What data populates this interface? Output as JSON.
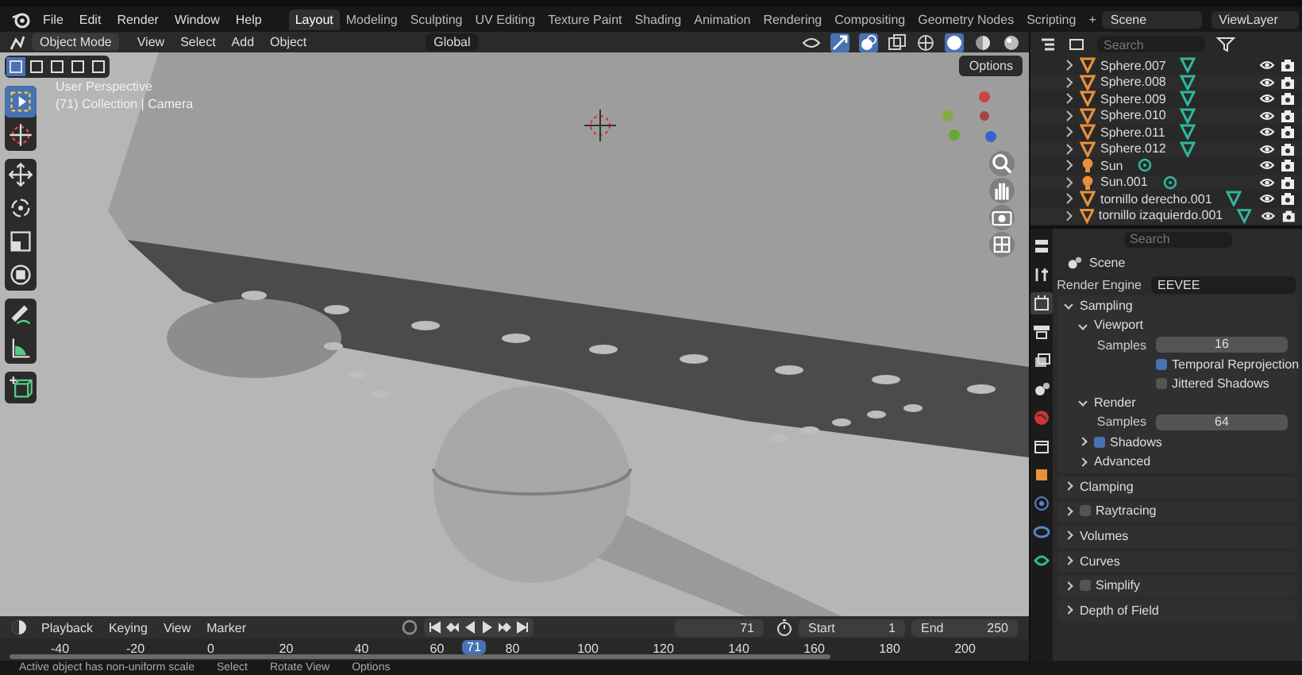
{
  "menu": [
    "File",
    "Edit",
    "Render",
    "Window",
    "Help"
  ],
  "workspaces": [
    {
      "label": "Layout",
      "selected": true
    },
    {
      "label": "Modeling",
      "selected": false
    },
    {
      "label": "Sculpting",
      "selected": false
    },
    {
      "label": "UV Editing",
      "selected": false
    },
    {
      "label": "Texture Paint",
      "selected": false
    },
    {
      "label": "Shading",
      "selected": false
    },
    {
      "label": "Animation",
      "selected": false
    },
    {
      "label": "Rendering",
      "selected": false
    },
    {
      "label": "Compositing",
      "selected": false
    },
    {
      "label": "Geometry Nodes",
      "selected": false
    },
    {
      "label": "Scripting",
      "selected": false
    }
  ],
  "add_workspace": "+",
  "scene": "Scene",
  "view_layer": "ViewLayer",
  "viewport_header": {
    "mode": "Object Mode",
    "menus": [
      "View",
      "Select",
      "Add",
      "Object"
    ],
    "orientation": "Global",
    "options": "Options"
  },
  "viewport": {
    "view_name": "User Perspective",
    "context": "(71) Collection | Camera"
  },
  "outliner": {
    "search_placeholder": "Search",
    "items": [
      {
        "name": "Sphere.007",
        "kind": "mesh"
      },
      {
        "name": "Sphere.008",
        "kind": "mesh"
      },
      {
        "name": "Sphere.009",
        "kind": "mesh"
      },
      {
        "name": "Sphere.010",
        "kind": "mesh"
      },
      {
        "name": "Sphere.011",
        "kind": "mesh"
      },
      {
        "name": "Sphere.012",
        "kind": "mesh"
      },
      {
        "name": "Sun",
        "kind": "light"
      },
      {
        "name": "Sun.001",
        "kind": "light"
      },
      {
        "name": "tornillo derecho.001",
        "kind": "mesh"
      },
      {
        "name": "tornillo izaquierdo.001",
        "kind": "mesh"
      }
    ]
  },
  "properties": {
    "search_placeholder": "Search",
    "context": "Scene",
    "render_engine_label": "Render Engine",
    "render_engine": "EEVEE",
    "sampling": {
      "label": "Sampling",
      "expanded": true,
      "subpanels": [
        {
          "label": "Viewport",
          "expanded": true,
          "rows": [
            {
              "kind": "number",
              "label": "Samples",
              "value": "16"
            },
            {
              "kind": "checkbox",
              "label": "Temporal Reprojection",
              "checked": true
            },
            {
              "kind": "checkbox",
              "label": "Jittered Shadows",
              "checked": false
            }
          ]
        },
        {
          "label": "Render",
          "expanded": true,
          "rows": [
            {
              "kind": "number",
              "label": "Samples",
              "value": "64"
            }
          ]
        },
        {
          "label": "Shadows",
          "expanded": false,
          "checked": true
        },
        {
          "label": "Advanced",
          "expanded": false
        }
      ]
    },
    "panels": [
      {
        "label": "Clamping",
        "expanded": false
      },
      {
        "label": "Raytracing",
        "expanded": false,
        "checked": false
      },
      {
        "label": "Volumes",
        "expanded": false
      },
      {
        "label": "Curves",
        "expanded": false
      },
      {
        "label": "Simplify",
        "expanded": false,
        "checked": false
      },
      {
        "label": "Depth of Field",
        "expanded": false
      }
    ]
  },
  "timeline": {
    "menus": [
      "Playback",
      "Keying",
      "View",
      "Marker"
    ],
    "frame": "71",
    "start_label": "Start",
    "start": "1",
    "end_label": "End",
    "end": "250",
    "ticks": [
      "-40",
      "-20",
      "0",
      "20",
      "40",
      "60",
      "80",
      "100",
      "120",
      "140",
      "160",
      "180",
      "200"
    ],
    "current_frame": "71"
  },
  "status_bar": [
    "Active object has non-uniform scale",
    "Select",
    "Rotate View",
    "Options"
  ]
}
